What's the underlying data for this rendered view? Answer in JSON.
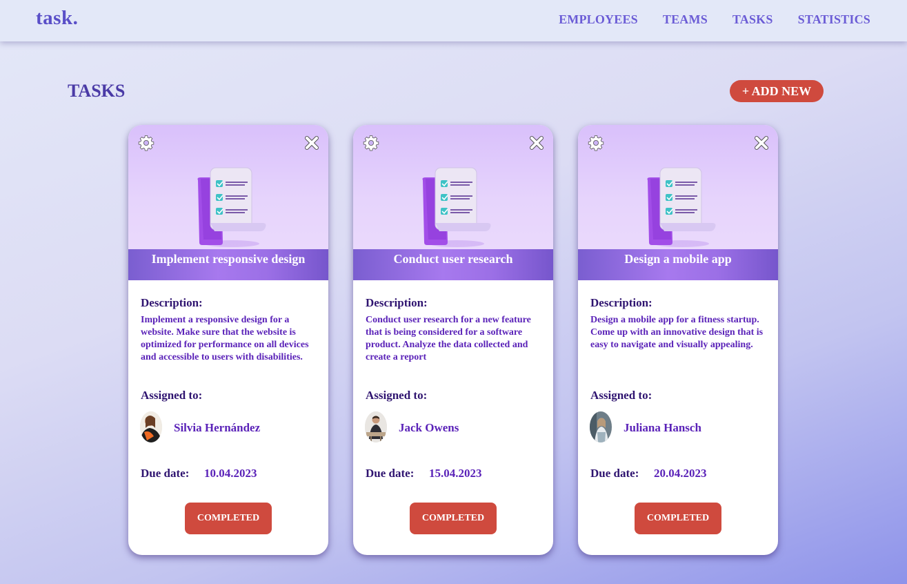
{
  "app": {
    "logo": "task.",
    "nav": [
      "EMPLOYEES",
      "TEAMS",
      "TASKS",
      "STATISTICS"
    ]
  },
  "page": {
    "title": "TASKS",
    "add_button": "+ ADD NEW"
  },
  "labels": {
    "description": "Description:",
    "assigned": "Assigned to:",
    "due": "Due date:"
  },
  "tasks": [
    {
      "title": "Implement responsive design",
      "description": "Implement a responsive design for a website. Make sure that the website is optimized for performance on all devices and accessible to users with disabilities.",
      "assignee": "Silvia Hernández",
      "due": "10.04.2023",
      "status": "COMPLETED"
    },
    {
      "title": "Conduct user research",
      "description": "Conduct user research for a new feature that is being considered for a software product. Analyze the data collected and create a report",
      "assignee": "Jack Owens",
      "due": "15.04.2023",
      "status": "COMPLETED"
    },
    {
      "title": "Design a mobile app",
      "description": "Design a mobile app for a fitness startup. Come up with an innovative design that is easy to navigate and visually appealing.",
      "assignee": "Juliana Hansch",
      "due": "20.04.2023",
      "status": "COMPLETED"
    }
  ],
  "colors": {
    "accent": "#cf4a3e",
    "brand": "#5a4fc8",
    "text_dark": "#2f1470",
    "text_purple": "#5a22b8"
  },
  "icons": {
    "settings": "gear-icon",
    "delete": "close-icon",
    "task_illustration": "checklist-scroll-icon"
  }
}
